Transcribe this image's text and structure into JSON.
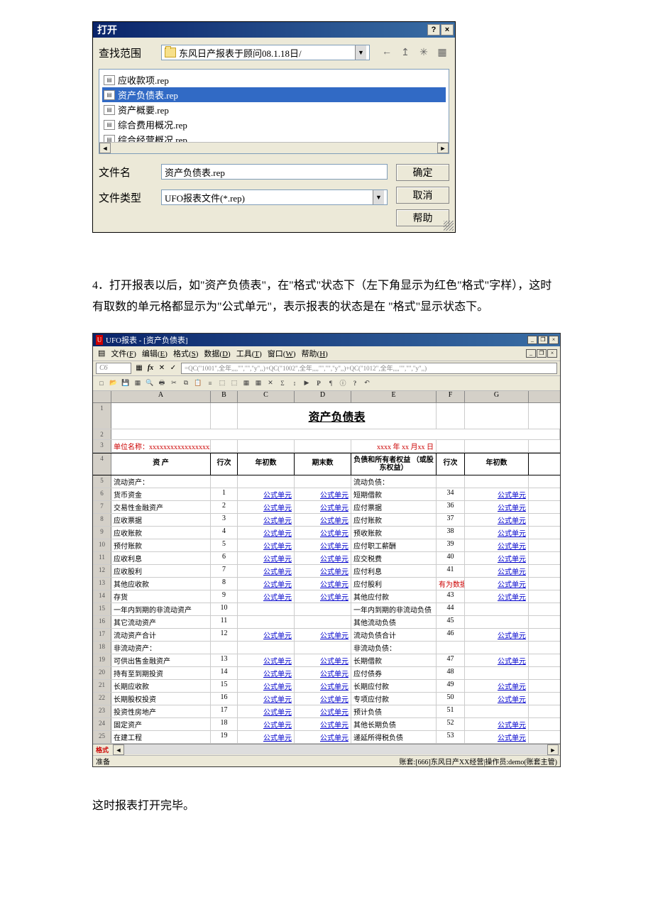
{
  "open_dialog": {
    "title": "打开",
    "help_btn": "?",
    "close_btn": "×",
    "lookin_label": "查找范围",
    "lookin_value": "东风日产报表于顾问08.1.18日/",
    "nav": {
      "back": "←",
      "up": "↥",
      "new": "✳",
      "views": "▦"
    },
    "files": [
      "应收款项.rep",
      "资产负债表.rep",
      "资产概要.rep",
      "综合费用概况.rep",
      "综合经营概况.rep"
    ],
    "selected_file_index": 1,
    "filename_label": "文件名",
    "filename_value": "资产负债表.rep",
    "filetype_label": "文件类型",
    "filetype_value": "UFO报表文件(*.rep)",
    "ok_btn": "确定",
    "cancel_btn": "取消",
    "help_btn2": "帮助"
  },
  "doc_text_1": "4．打开报表以后，如\"资产负债表\"，在\"格式\"状态下（左下角显示为红色\"格式\"字样），这时有取数的单元格都显示为\"公式单元\"，表示报表的状态是在 \"格式\"显示状态下。",
  "ufo": {
    "title": "UFO报表 - [资产负债表]",
    "menu": [
      {
        "t": "文件",
        "k": "F"
      },
      {
        "t": "编辑",
        "k": "E"
      },
      {
        "t": "格式",
        "k": "S"
      },
      {
        "t": "数据",
        "k": "D"
      },
      {
        "t": "工具",
        "k": "T"
      },
      {
        "t": "窗口",
        "k": "W"
      },
      {
        "t": "帮助",
        "k": "H"
      }
    ],
    "cell_ref": "C6",
    "formula": "=QC(\"1001\",全年,,,,\"\",\"\",\"y\",,)+QC(\"1002\",全年,,,,\"\",\"\",\"y\",,)+QC(\"1012\",全年,,,,\"\",\"\",\"y\",,)",
    "cols": [
      "A",
      "B",
      "C",
      "D",
      "E",
      "F",
      "G"
    ],
    "sheet_title": "资产负债表",
    "unit_label": "单位名称：",
    "unit_value": "xxxxxxxxxxxxxxxxxxxxxxxxxxxx",
    "date_label": "xxxx 年   xx 月xx 日",
    "headers": [
      "资   产",
      "行次",
      "年初数",
      "期末数",
      "负债和所有者权益\n（或股东权益）",
      "行次",
      "年初数"
    ],
    "formula_cell": "公式单元",
    "rows": [
      {
        "n": 5,
        "a": "流动资产：",
        "b": "",
        "c": "",
        "d": "",
        "e": "流动负债：",
        "f": "",
        "g": ""
      },
      {
        "n": 6,
        "a": "    货币资金",
        "b": "1",
        "c": "f",
        "d": "f",
        "e": "    短期借款",
        "f": "34",
        "g": "f"
      },
      {
        "n": 7,
        "a": "    交易性金融资产",
        "b": "2",
        "c": "f",
        "d": "f",
        "e": "    应付票据",
        "f": "36",
        "g": "f"
      },
      {
        "n": 8,
        "a": "    应收票据",
        "b": "3",
        "c": "f",
        "d": "f",
        "e": "    应付账款",
        "f": "37",
        "g": "f"
      },
      {
        "n": 9,
        "a": "    应收账款",
        "b": "4",
        "c": "f",
        "d": "f",
        "e": "    预收账款",
        "f": "38",
        "g": "f"
      },
      {
        "n": 10,
        "a": "    预付账款",
        "b": "5",
        "c": "f",
        "d": "f",
        "e": "    应付职工薪酬",
        "f": "39",
        "g": "f"
      },
      {
        "n": 11,
        "a": "    应收利息",
        "b": "6",
        "c": "f",
        "d": "f",
        "e": "    应交税费",
        "f": "40",
        "g": "f"
      },
      {
        "n": 12,
        "a": "    应收股利",
        "b": "7",
        "c": "f",
        "d": "f",
        "e": "    应付利息",
        "f": "41",
        "g": "f"
      },
      {
        "n": 13,
        "a": "    其他应收款",
        "b": "8",
        "c": "f",
        "d": "f",
        "e": "    应付股利",
        "f": "有为数据",
        "fred": true,
        "g": "f"
      },
      {
        "n": 14,
        "a": "    存货",
        "b": "9",
        "c": "f",
        "d": "f",
        "e": "    其他应付款",
        "f": "43",
        "g": "f"
      },
      {
        "n": 15,
        "a": "    一年内到期的非流动资产",
        "b": "10",
        "c": "",
        "d": "",
        "e": "    一年内到期的非流动负债",
        "f": "44",
        "g": ""
      },
      {
        "n": 16,
        "a": "    其它流动资产",
        "b": "11",
        "c": "",
        "d": "",
        "e": "    其他流动负债",
        "f": "45",
        "g": ""
      },
      {
        "n": 17,
        "a": "        流动资产合计",
        "b": "12",
        "c": "f",
        "d": "f",
        "e": "        流动负债合计",
        "f": "46",
        "g": "f"
      },
      {
        "n": 18,
        "a": "非流动资产：",
        "b": "",
        "c": "",
        "d": "",
        "e": "非流动负债：",
        "f": "",
        "g": ""
      },
      {
        "n": 19,
        "a": "    可供出售金融资产",
        "b": "13",
        "c": "f",
        "d": "f",
        "e": "    长期借款",
        "f": "47",
        "g": "f"
      },
      {
        "n": 20,
        "a": "    持有至到期投资",
        "b": "14",
        "c": "f",
        "d": "f",
        "e": "    应付债券",
        "f": "48",
        "g": ""
      },
      {
        "n": 21,
        "a": "    长期应收款",
        "b": "15",
        "c": "f",
        "d": "f",
        "e": "    长期应付款",
        "f": "49",
        "g": "f"
      },
      {
        "n": 22,
        "a": "    长期股权投资",
        "b": "16",
        "c": "f",
        "d": "f",
        "e": "    专项应付款",
        "f": "50",
        "g": "f"
      },
      {
        "n": 23,
        "a": "    投资性房地产",
        "b": "17",
        "c": "f",
        "d": "f",
        "e": "    预计负债",
        "f": "51",
        "g": ""
      },
      {
        "n": 24,
        "a": "    固定资产",
        "b": "18",
        "c": "f",
        "d": "f",
        "e": "    其他长期负债",
        "f": "52",
        "g": "f"
      },
      {
        "n": 25,
        "a": "    在建工程",
        "b": "19",
        "c": "f",
        "d": "f",
        "e": "    递延所得税负债",
        "f": "53",
        "g": "f"
      }
    ],
    "status_mode": "格式",
    "status_ready": "准备",
    "status_right": "账套:[666]东风日产XX经营|操作员:demo(账套主管)"
  },
  "doc_text_2": "这时报表打开完毕。"
}
